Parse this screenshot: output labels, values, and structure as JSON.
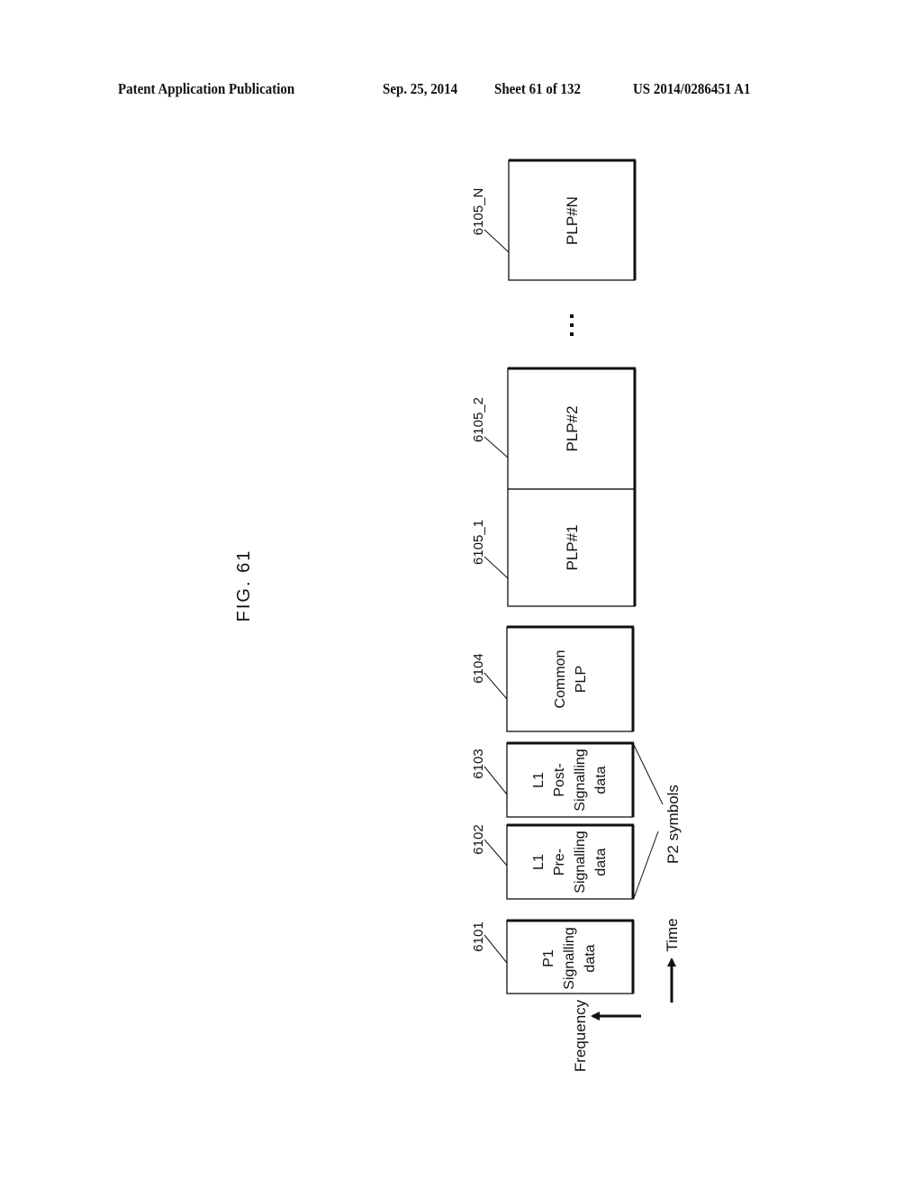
{
  "header": {
    "publication": "Patent Application Publication",
    "date": "Sep. 25, 2014",
    "sheet": "Sheet 61 of 132",
    "number": "US 2014/0286451 A1"
  },
  "figure": {
    "title": "FIG. 61"
  },
  "blocks": [
    {
      "id": "6101",
      "lines": [
        "P1",
        "Signalling",
        "data"
      ]
    },
    {
      "id": "6102",
      "lines": [
        "L1",
        "Pre-",
        "Signalling",
        "data"
      ]
    },
    {
      "id": "6103",
      "lines": [
        "L1",
        "Post-",
        "Signalling",
        "data"
      ]
    },
    {
      "id": "6104",
      "lines": [
        "Common",
        "PLP"
      ]
    },
    {
      "id": "6105_1",
      "lines": [
        "PLP#1"
      ]
    },
    {
      "id": "6105_2",
      "lines": [
        "PLP#2"
      ]
    },
    {
      "id": "6105_N",
      "lines": [
        "PLP#N"
      ]
    }
  ],
  "ellipsis": "…",
  "annotations": {
    "p2_symbols": "P2 symbols",
    "frequency": "Frequency",
    "time": "Time"
  }
}
